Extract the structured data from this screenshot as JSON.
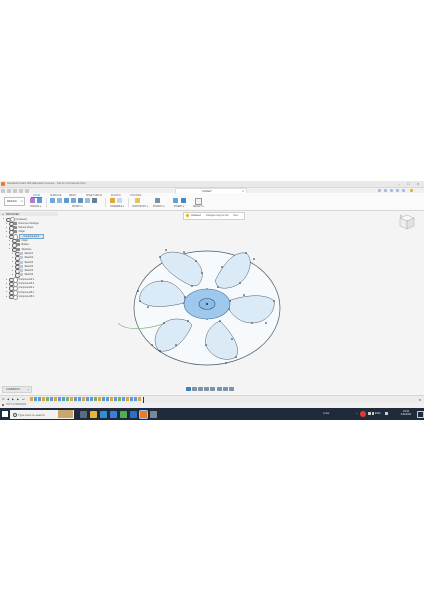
{
  "window": {
    "title": "Autodesk Fusion 360 (Education License – Not for Commercial Use)",
    "document_tab": "Untitled*",
    "controls": "–  ☐  ✕"
  },
  "ribbon": {
    "workspace_label": "DESIGN",
    "tabs": [
      "SOLID",
      "SURFACE",
      "MESH",
      "SHEET METAL",
      "PLASTIC",
      "UTILITIES"
    ],
    "active_tab": "SOLID",
    "groups": [
      "CREATE ▾",
      "MODIFY ▾",
      "ASSEMBLE ▾",
      "CONSTRUCT ▾",
      "INSPECT ▾",
      "INSERT ▾",
      "SELECT ▾"
    ]
  },
  "browser": {
    "header": "BROWSER",
    "items": [
      {
        "label": "(Unsaved)",
        "indent": 0,
        "kind": "comp"
      },
      {
        "label": "Document Settings",
        "indent": 1,
        "kind": "folder"
      },
      {
        "label": "Named Views",
        "indent": 1,
        "kind": "folder"
      },
      {
        "label": "Origin",
        "indent": 1,
        "kind": "folder"
      },
      {
        "label": "Component1:1",
        "indent": 1,
        "kind": "comp",
        "selected": true
      },
      {
        "label": "Origin",
        "indent": 2,
        "kind": "folder"
      },
      {
        "label": "Bodies",
        "indent": 2,
        "kind": "folder"
      },
      {
        "label": "Sketches",
        "indent": 2,
        "kind": "folder"
      },
      {
        "label": "Sketch1",
        "indent": 3,
        "kind": "sketch"
      },
      {
        "label": "Sketch2",
        "indent": 3,
        "kind": "sketch"
      },
      {
        "label": "Sketch3",
        "indent": 3,
        "kind": "sketch"
      },
      {
        "label": "Sketch4",
        "indent": 3,
        "kind": "sketch"
      },
      {
        "label": "Sketch5",
        "indent": 3,
        "kind": "sketch"
      },
      {
        "label": "Sketch6",
        "indent": 3,
        "kind": "sketch"
      },
      {
        "label": "Component2:1",
        "indent": 1,
        "kind": "comp"
      },
      {
        "label": "Component3:1",
        "indent": 1,
        "kind": "comp"
      },
      {
        "label": "Component4:1",
        "indent": 1,
        "kind": "comp"
      },
      {
        "label": "Component5:1",
        "indent": 1,
        "kind": "comp"
      },
      {
        "label": "Component6:1",
        "indent": 1,
        "kind": "comp"
      }
    ]
  },
  "dialog_strip": {
    "warning": "Unsaved:",
    "message": "Changes may be lost",
    "action": "Save"
  },
  "comments": {
    "label": "COMMENTS",
    "toggle": "+"
  },
  "timeline": {
    "controls": [
      "⏮",
      "◀",
      "▶",
      "▶",
      "⏭"
    ],
    "feature_colors": [
      "#e0a53b",
      "#5b9bd5",
      "#5b9bd5",
      "#e0a53b",
      "#7bb06a",
      "#5b9bd5",
      "#e0a53b",
      "#5b9bd5",
      "#5b9bd5",
      "#7bb06a",
      "#e0a53b",
      "#5b9bd5",
      "#5b9bd5",
      "#e0a53b",
      "#5b9bd5",
      "#5b9bd5",
      "#7bb06a",
      "#e0a53b",
      "#5b9bd5",
      "#5b9bd5",
      "#e0a53b",
      "#5b9bd5",
      "#7bb06a",
      "#5b9bd5",
      "#e0a53b",
      "#5b9bd5",
      "#5b9bd5",
      "#e0a53b"
    ],
    "settings": "⚙"
  },
  "status": {
    "text": "TEXT COMMANDS"
  },
  "taskbar": {
    "search_placeholder": "Type here to search",
    "apps": [
      {
        "name": "task-view",
        "color": "#5a6b80"
      },
      {
        "name": "file-explorer",
        "color": "#e8b43a"
      },
      {
        "name": "edge",
        "color": "#2d8fd5"
      },
      {
        "name": "store",
        "color": "#3c7dd9"
      },
      {
        "name": "chrome",
        "color": "#4caf50"
      },
      {
        "name": "mail",
        "color": "#2f6fc2"
      },
      {
        "name": "fusion",
        "color": "#ee7b22"
      },
      {
        "name": "settings",
        "color": "#7d8896"
      }
    ],
    "weather": "Links",
    "language": "ENG",
    "time": "16:04",
    "date": "4/11/2021"
  },
  "colors": {
    "accent": "#0696d7",
    "sketch_profile": "#dbeaf7",
    "sketch_hub": "#9ec9ec",
    "sketch_line": "#4a5866",
    "taskbar": "#1f2b3a"
  }
}
